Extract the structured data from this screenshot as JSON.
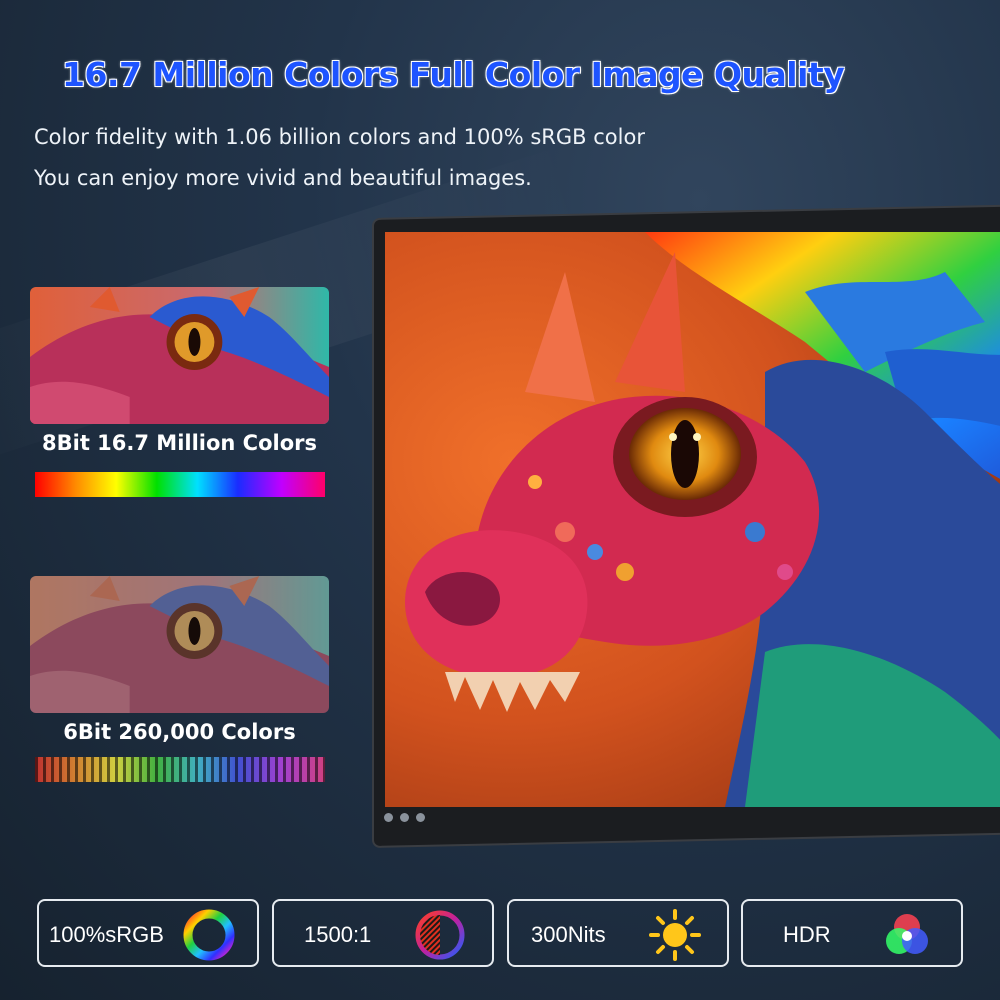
{
  "headline": "16.7 Million Colors Full Color Image Quality",
  "subtitle_line1": "Color fidelity with 1.06 billion colors and 100% sRGB color",
  "subtitle_line2": "You can enjoy more vivid and beautiful images.",
  "comparison": {
    "eight_bit_label": "8Bit 16.7 Million Colors",
    "six_bit_label": "6Bit 260,000 Colors"
  },
  "features": [
    {
      "label": "100%sRGB",
      "icon": "color-wheel-icon"
    },
    {
      "label": "1500:1",
      "icon": "contrast-icon"
    },
    {
      "label": "300Nits",
      "icon": "sun-icon"
    },
    {
      "label": "HDR",
      "icon": "rgb-circles-icon"
    }
  ],
  "colors": {
    "headline": "#1e54ff",
    "background": "#1c2a3c",
    "text": "#eef3f8"
  }
}
